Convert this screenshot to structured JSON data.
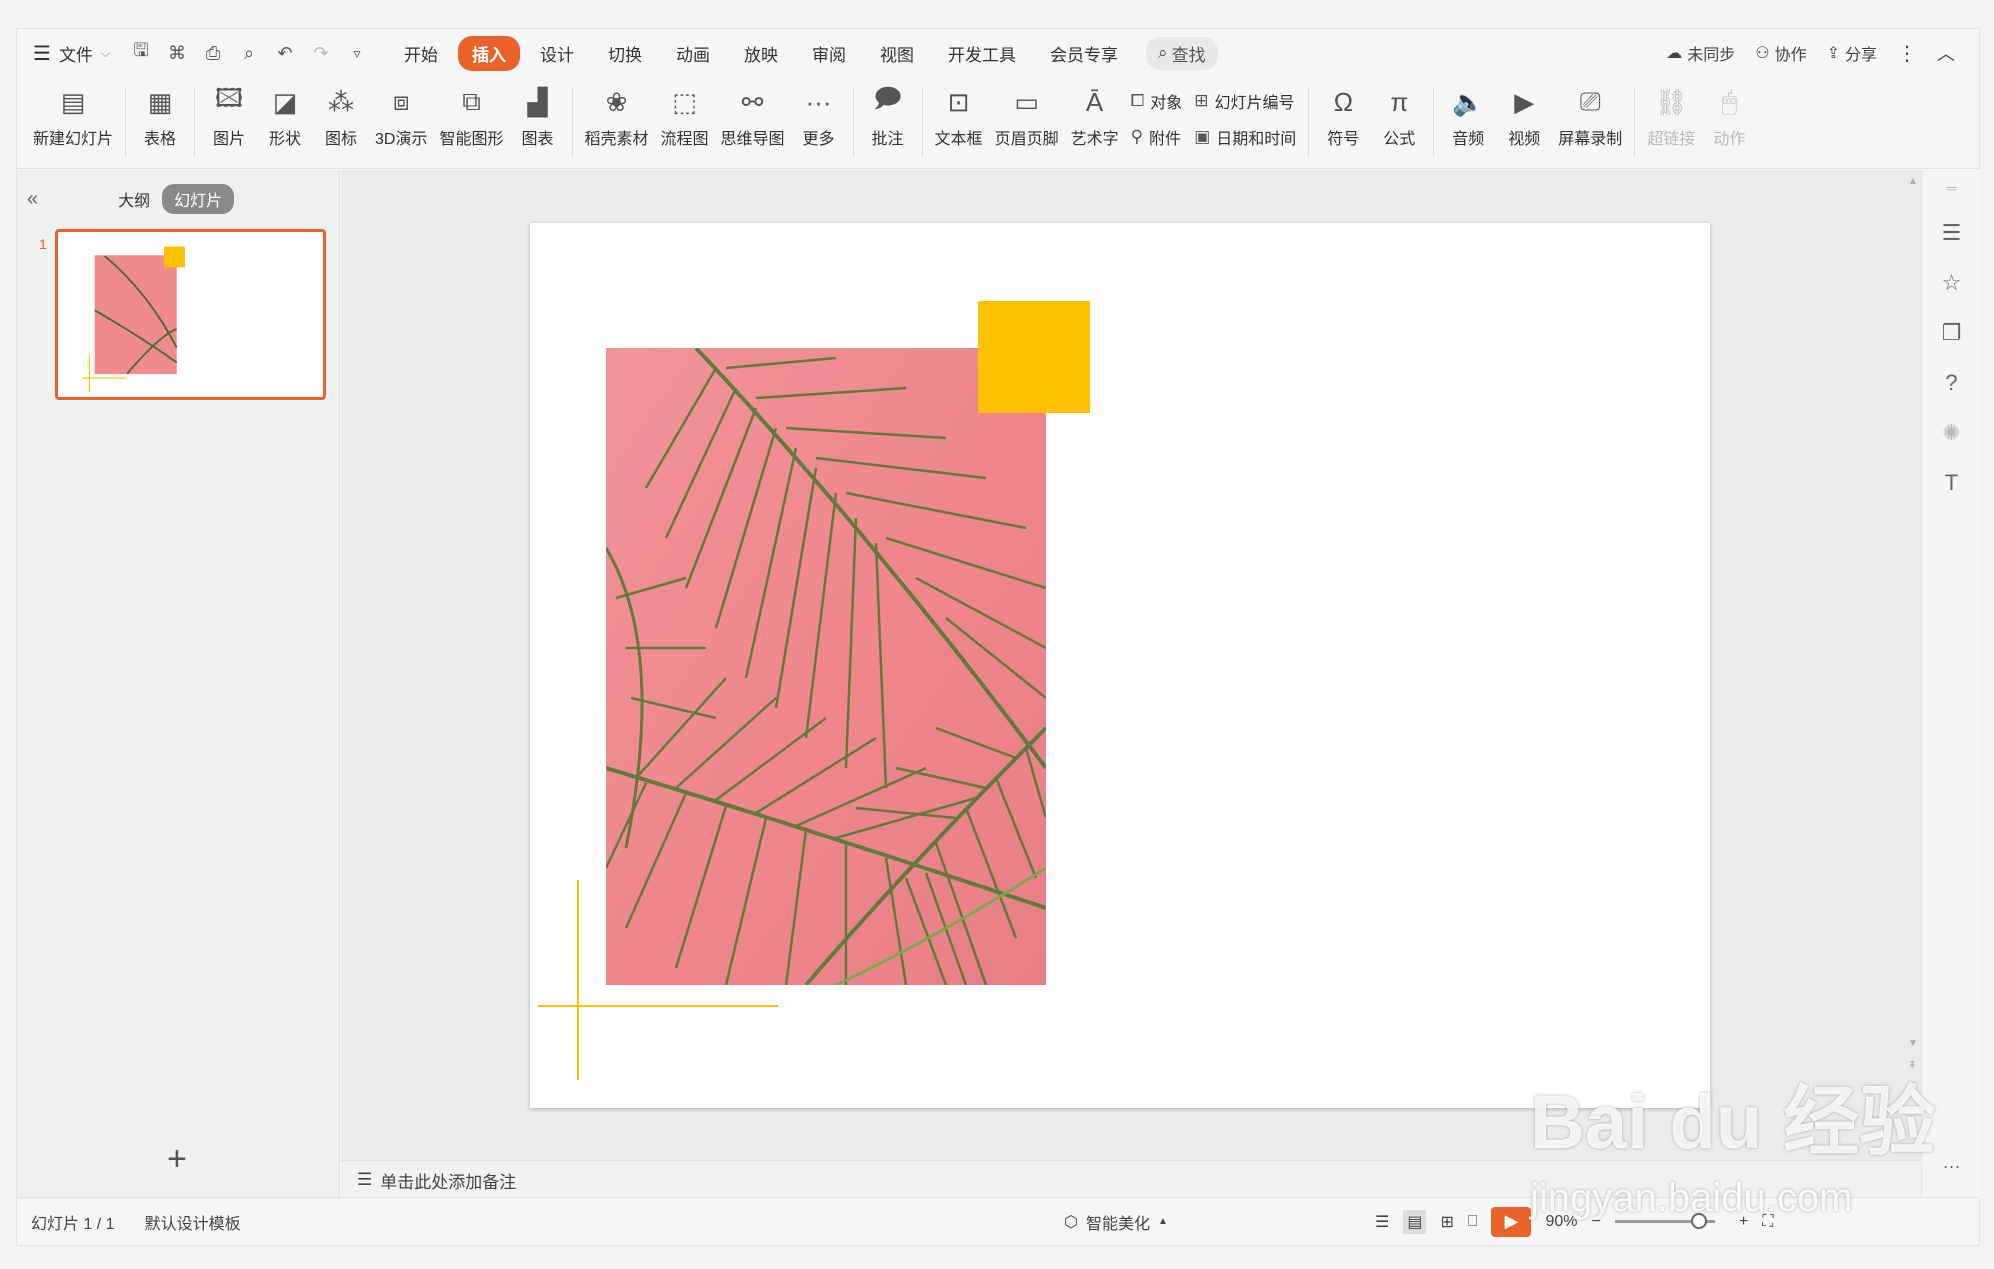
{
  "menubar": {
    "file_label": "文件",
    "tabs": [
      {
        "label": "开始",
        "active": false
      },
      {
        "label": "插入",
        "active": true
      },
      {
        "label": "设计",
        "active": false
      },
      {
        "label": "切换",
        "active": false
      },
      {
        "label": "动画",
        "active": false
      },
      {
        "label": "放映",
        "active": false
      },
      {
        "label": "审阅",
        "active": false
      },
      {
        "label": "视图",
        "active": false
      },
      {
        "label": "开发工具",
        "active": false
      },
      {
        "label": "会员专享",
        "active": false
      }
    ],
    "search_label": "查找",
    "right": {
      "sync": "未同步",
      "collab": "协作",
      "share": "分享"
    }
  },
  "ribbon": {
    "new_slide": "新建幻灯片",
    "table": "表格",
    "picture": "图片",
    "shape": "形状",
    "icon": "图标",
    "demo3d": "3D演示",
    "smartart": "智能图形",
    "chart": "图表",
    "material": "稻壳素材",
    "flowchart": "流程图",
    "mindmap": "思维导图",
    "more": "更多",
    "comment": "批注",
    "textbox": "文本框",
    "header_footer": "页眉页脚",
    "wordart": "艺术字",
    "object": "对象",
    "attachment": "附件",
    "slide_number": "幻灯片编号",
    "date_time": "日期和时间",
    "symbol": "符号",
    "formula": "公式",
    "audio": "音频",
    "video": "视频",
    "screen_record": "屏幕录制",
    "hyperlink": "超链接",
    "action": "动作"
  },
  "leftpanel": {
    "outline": "大纲",
    "slides": "幻灯片",
    "slide_number": "1"
  },
  "notes": {
    "placeholder": "单击此处添加备注"
  },
  "status": {
    "slide_info": "幻灯片 1 / 1",
    "template": "默认设计模板",
    "beautify": "智能美化",
    "zoom": "90%"
  },
  "colors": {
    "accent": "#e8622a",
    "yellow": "#ffc000",
    "pink": "#ef8a8f"
  },
  "watermark": {
    "main": "Bai du 经验",
    "sub": "jingyan.baidu.com"
  }
}
